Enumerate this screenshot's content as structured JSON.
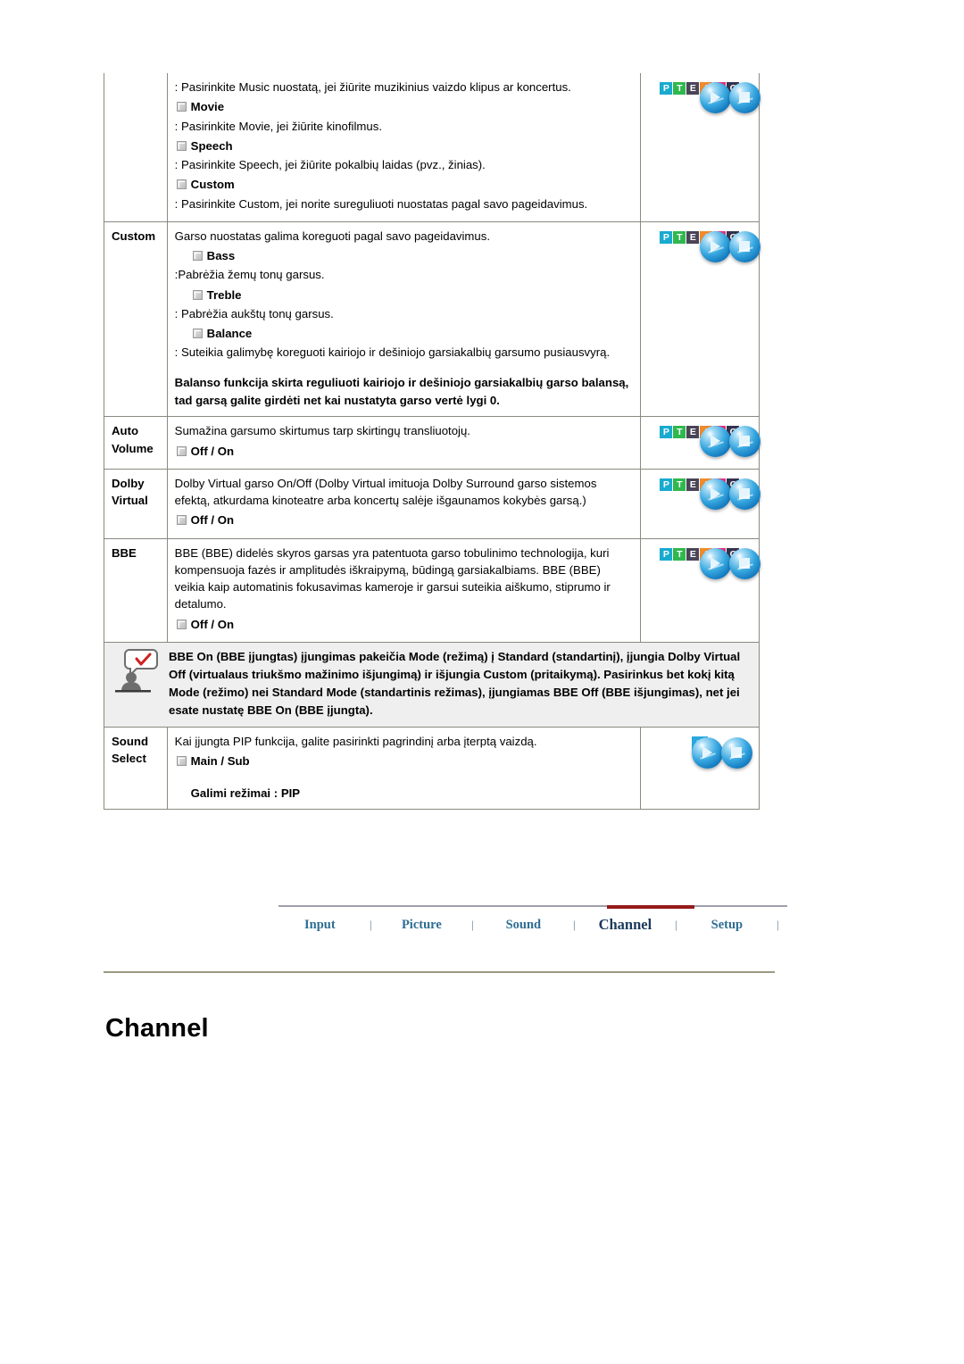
{
  "table": {
    "rows": [
      {
        "label": "",
        "icon": "pteasc-logo",
        "blocks": [
          {
            "type": "text",
            "value": ": Pasirinkite Music nuostatą, jei žiūrite muzikinius vaizdo klipus ar koncertus."
          },
          {
            "type": "sub",
            "value": "Movie"
          },
          {
            "type": "text",
            "value": ": Pasirinkite Movie, jei žiūrite kinofilmus."
          },
          {
            "type": "sub",
            "value": "Speech"
          },
          {
            "type": "text",
            "value": ": Pasirinkite Speech, jei žiūrite pokalbių laidas (pvz., žinias)."
          },
          {
            "type": "sub",
            "value": "Custom"
          },
          {
            "type": "text",
            "value": ": Pasirinkite Custom, jei norite sureguliuoti nuostatas pagal savo pageidavimus."
          }
        ]
      },
      {
        "label": "Custom",
        "icon": "pteasc-logo",
        "blocks": [
          {
            "type": "text",
            "value": "Garso nuostatas galima koreguoti pagal savo pageidavimus."
          },
          {
            "type": "sub-indent",
            "value": "Bass"
          },
          {
            "type": "text",
            "value": ":Pabrėžia žemų tonų garsus."
          },
          {
            "type": "sub-indent",
            "value": "Treble"
          },
          {
            "type": "text",
            "value": ": Pabrėžia aukštų tonų garsus."
          },
          {
            "type": "sub-indent",
            "value": "Balance"
          },
          {
            "type": "text",
            "value": ": Suteikia galimybę koreguoti kairiojo ir dešiniojo garsiakalbių garsumo pusiausvyrą."
          },
          {
            "type": "bold",
            "value": "Balanso funkcija skirta reguliuoti kairiojo ir dešiniojo garsiakalbių garso balansą, tad garsą galite girdėti net kai nustatyta garso vertė lygi 0."
          }
        ]
      },
      {
        "label": "Auto Volume",
        "label_lines": [
          "Auto",
          "Volume"
        ],
        "icon": "pteasc-logo",
        "blocks": [
          {
            "type": "text",
            "value": "Sumažina garsumo skirtumus tarp skirtingų transliuotojų."
          },
          {
            "type": "sub",
            "value": "Off / On"
          }
        ]
      },
      {
        "label": "Dolby Virtual",
        "label_lines": [
          "Dolby",
          "Virtual"
        ],
        "icon": "pteasc-logo",
        "blocks": [
          {
            "type": "text",
            "value": "Dolby Virtual garso On/Off (Dolby Virtual imituoja Dolby Surround garso sistemos efektą, atkurdama kinoteatre arba koncertų salėje išgaunamos kokybės garsą.)"
          },
          {
            "type": "sub",
            "value": "Off / On"
          }
        ]
      },
      {
        "label": "BBE",
        "label_lines": [
          "BBE"
        ],
        "icon": "pteasc-logo",
        "blocks": [
          {
            "type": "text",
            "value": "BBE (BBE) didelės skyros garsas yra patentuota garso tobulinimo technologija, kuri kompensuoja fazės ir amplitudės iškraipymą, būdingą garsiakalbiams. BBE (BBE) veikia kaip automatinis fokusavimas kameroje ir garsui suteikia aiškumo, stiprumo ir detalumo."
          },
          {
            "type": "sub",
            "value": "Off / On"
          }
        ]
      },
      {
        "label": "Sound Select",
        "label_lines": [
          "Sound",
          "Select"
        ],
        "icon": "pip-logo",
        "blocks": [
          {
            "type": "text",
            "value": "Kai įjungta PIP funkcija, galite pasirinkti pagrindinį arba įterptą vaizdą."
          },
          {
            "type": "sub",
            "value": "Main / Sub"
          },
          {
            "type": "plain-bold",
            "value": "Galimi režimai : PIP"
          }
        ]
      }
    ],
    "note": {
      "icon": "note-person-checkmark-icon",
      "text": "BBE On (BBE įjungtas) įjungimas pakeičia Mode (režimą) į Standard (standartinį), įjungia Dolby Virtual Off (virtualaus triukšmo mažinimo išjungimą) ir išjungia Custom (pritaikymą). Pasirinkus bet kokį kitą Mode (režimo) nei Standard Mode (standartinis režimas), įjungiamas BBE Off (BBE išjungimas), net jei esate nustatę BBE On (BBE įjungta)."
    }
  },
  "logo": {
    "letters": [
      "P",
      "T",
      "E",
      "A",
      "S",
      "C"
    ],
    "pip_letter": "P",
    "colors": {
      "P": "#19aacf",
      "T": "#2fb84e",
      "E": "#4a4458",
      "A": "#f08a2a",
      "S": "#e0327f",
      "C": "#33324e",
      "pip": "#29a9dd"
    }
  },
  "nav": {
    "separator": "|",
    "active_color": "#961b1b",
    "link_color": "#2e6e93",
    "items": [
      {
        "label": "Input",
        "active": false
      },
      {
        "label": "Picture",
        "active": false
      },
      {
        "label": "Sound",
        "active": false
      },
      {
        "label": "Channel",
        "active": true
      },
      {
        "label": "Setup",
        "active": false
      }
    ]
  },
  "page": {
    "title": "Channel"
  }
}
